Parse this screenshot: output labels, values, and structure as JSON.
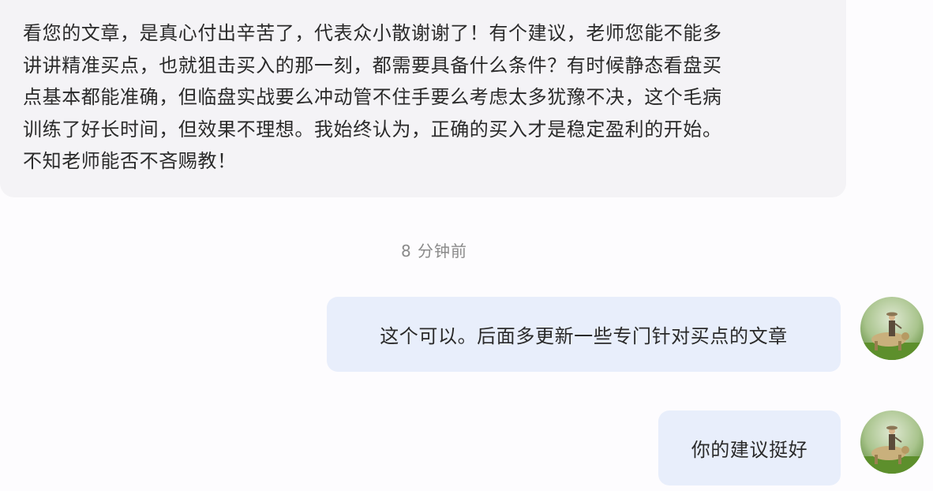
{
  "chat": {
    "incoming_message": {
      "text": "看您的文章，是真心付出辛苦了，代表众小散谢谢了！有个建议，老师您能不能多\n讲讲精准买点，也就狙击买入的那一刻，都需要具备什么条件？有时候静态看盘买\n点基本都能准确，但临盘实战要么冲动管不住手要么考虑太多犹豫不决，这个毛病\n训练了好长时间，但效果不理想。我始终认为，正确的买入才是稳定盈利的开始。\n不知老师能否不吝赐教！"
    },
    "timestamp": "8 分钟前",
    "outgoing_messages": [
      {
        "text": "这个可以。后面多更新一些专门针对买点的文章"
      },
      {
        "text": "你的建议挺好"
      }
    ]
  },
  "colors": {
    "incoming_bubble": "#f4f3f6",
    "outgoing_bubble": "#e8eefb",
    "text": "#2a2a2a",
    "timestamp": "#8a8a8a",
    "background": "#fdfcfe"
  },
  "icons": {
    "avatar": "avatar-man-on-buffalo"
  }
}
